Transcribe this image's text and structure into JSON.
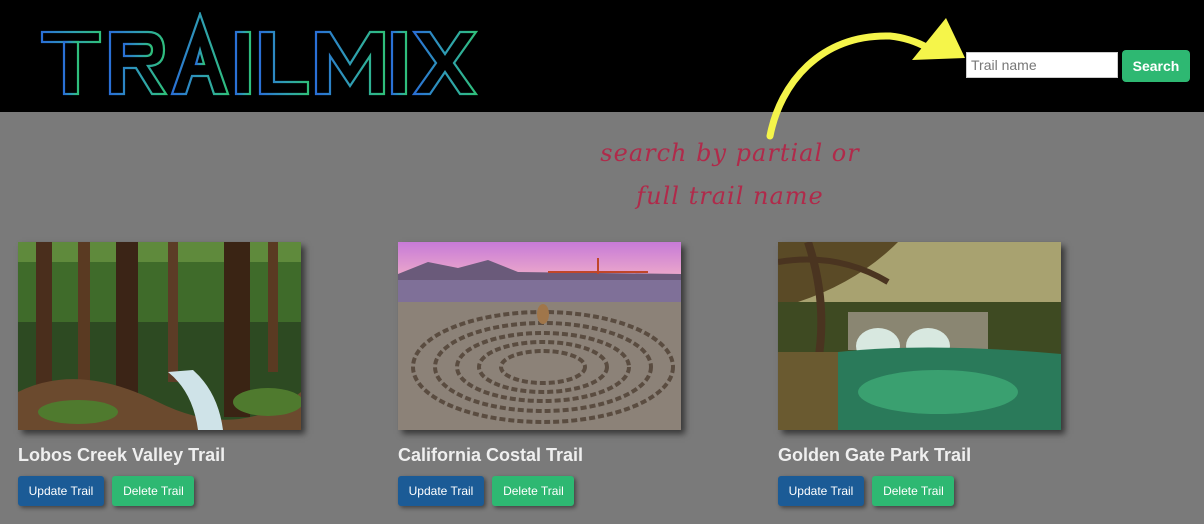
{
  "header": {
    "logo_text": "TRAILMIX",
    "search": {
      "placeholder": "Trail name",
      "value": "",
      "button_label": "Search"
    }
  },
  "annotation": {
    "line1": "search by partial or",
    "line2": "full trail name",
    "arrow_color": "#f5f54a",
    "text_color": "#b02a4a"
  },
  "trails": [
    {
      "name": "Lobos Creek Valley Trail",
      "update_label": "Update Trail",
      "delete_label": "Delete Trail"
    },
    {
      "name": "California Costal Trail",
      "update_label": "Update Trail",
      "delete_label": "Delete Trail"
    },
    {
      "name": "Golden Gate Park Trail",
      "update_label": "Update Trail",
      "delete_label": "Delete Trail"
    }
  ],
  "colors": {
    "header_bg": "#000000",
    "page_bg": "#7a7a7a",
    "primary_green": "#2eb872",
    "update_blue": "#1b5b96",
    "logo_blue": "#2f7fd8",
    "logo_green": "#2fbf8a"
  }
}
